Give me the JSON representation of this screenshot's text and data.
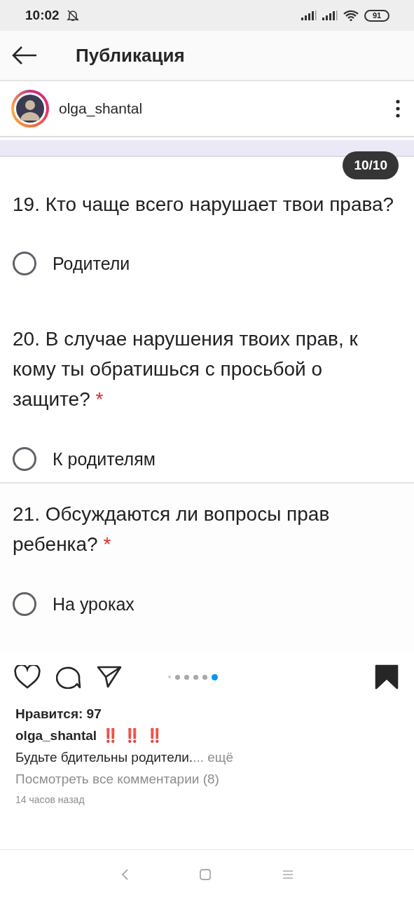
{
  "status_bar": {
    "time": "10:02",
    "battery": "91"
  },
  "header": {
    "title": "Публикация"
  },
  "post_header": {
    "username": "olga_shantal"
  },
  "post_image": {
    "counter": "10/10",
    "sections": [
      {
        "question": "19. Кто чаще всего нарушает твои права?",
        "options": [
          {
            "label": "Родители",
            "selected": false
          }
        ]
      },
      {
        "question": "20. В случае нарушения твоих прав, к кому ты обратишься с просьбой о защите?",
        "required_mark": "*",
        "options": [
          {
            "label": "К родителям",
            "selected": false
          }
        ]
      },
      {
        "question": "21. Обсуждаются ли вопросы прав ребенка?",
        "required_mark": "*",
        "options": [
          {
            "label": "На уроках",
            "selected": false
          }
        ]
      }
    ]
  },
  "carousel_dots": [
    {
      "selected": false
    },
    {
      "selected": false
    },
    {
      "selected": false
    },
    {
      "selected": false
    },
    {
      "selected": false
    },
    {
      "selected": true
    }
  ],
  "actions": {
    "saved": true
  },
  "likes": "Нравится: 97",
  "caption": {
    "username": "olga_shantal",
    "emoji": "‼️ ‼️ ‼️",
    "text": "Будьте бдительны родители.",
    "more": "... ещё"
  },
  "comments_link": "Посмотреть все комментарии (8)",
  "time_ago": "14 часов назад"
}
